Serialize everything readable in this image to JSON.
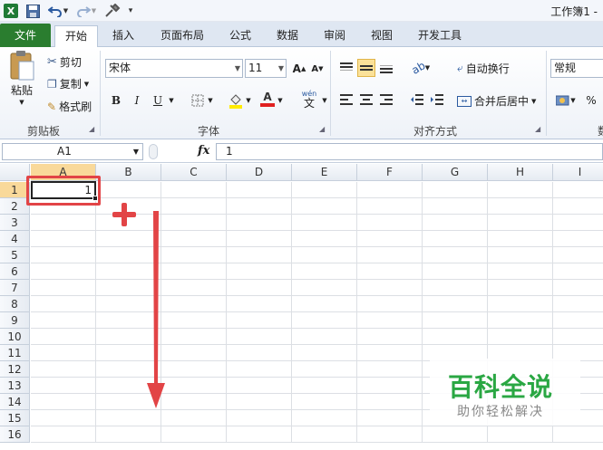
{
  "titlebar": {
    "app_title": "工作簿1 -"
  },
  "tabs": [
    "文件",
    "开始",
    "插入",
    "页面布局",
    "公式",
    "数据",
    "审阅",
    "视图",
    "开发工具"
  ],
  "ribbon": {
    "clipboard": {
      "paste": "粘贴",
      "cut": "剪切",
      "copy": "复制",
      "format_painter": "格式刷",
      "label": "剪贴板"
    },
    "font": {
      "name": "宋体",
      "size": "11",
      "bold": "B",
      "italic": "I",
      "underline": "U",
      "label": "字体"
    },
    "alignment": {
      "wrap_text": "自动换行",
      "merge_center": "合并后居中",
      "label": "对齐方式"
    },
    "number": {
      "format": "常规",
      "percent": "%",
      "label": "数"
    }
  },
  "formula_bar": {
    "name_box": "A1",
    "fx": "fx",
    "value": "1"
  },
  "columns": [
    "A",
    "B",
    "C",
    "D",
    "E",
    "F",
    "G",
    "H",
    "I"
  ],
  "rows": [
    "1",
    "2",
    "3",
    "4",
    "5",
    "6",
    "7",
    "8",
    "9",
    "10",
    "11",
    "12",
    "13",
    "14",
    "15",
    "16"
  ],
  "cells": {
    "A1": "1"
  },
  "colors": {
    "annotation_red": "#e24446",
    "file_tab_green": "#2a7d2f",
    "selected_header": "#f9d99a",
    "watermark_green": "#2aa743"
  },
  "watermark": {
    "main": "百科全说",
    "sub": "助你轻松解决"
  }
}
